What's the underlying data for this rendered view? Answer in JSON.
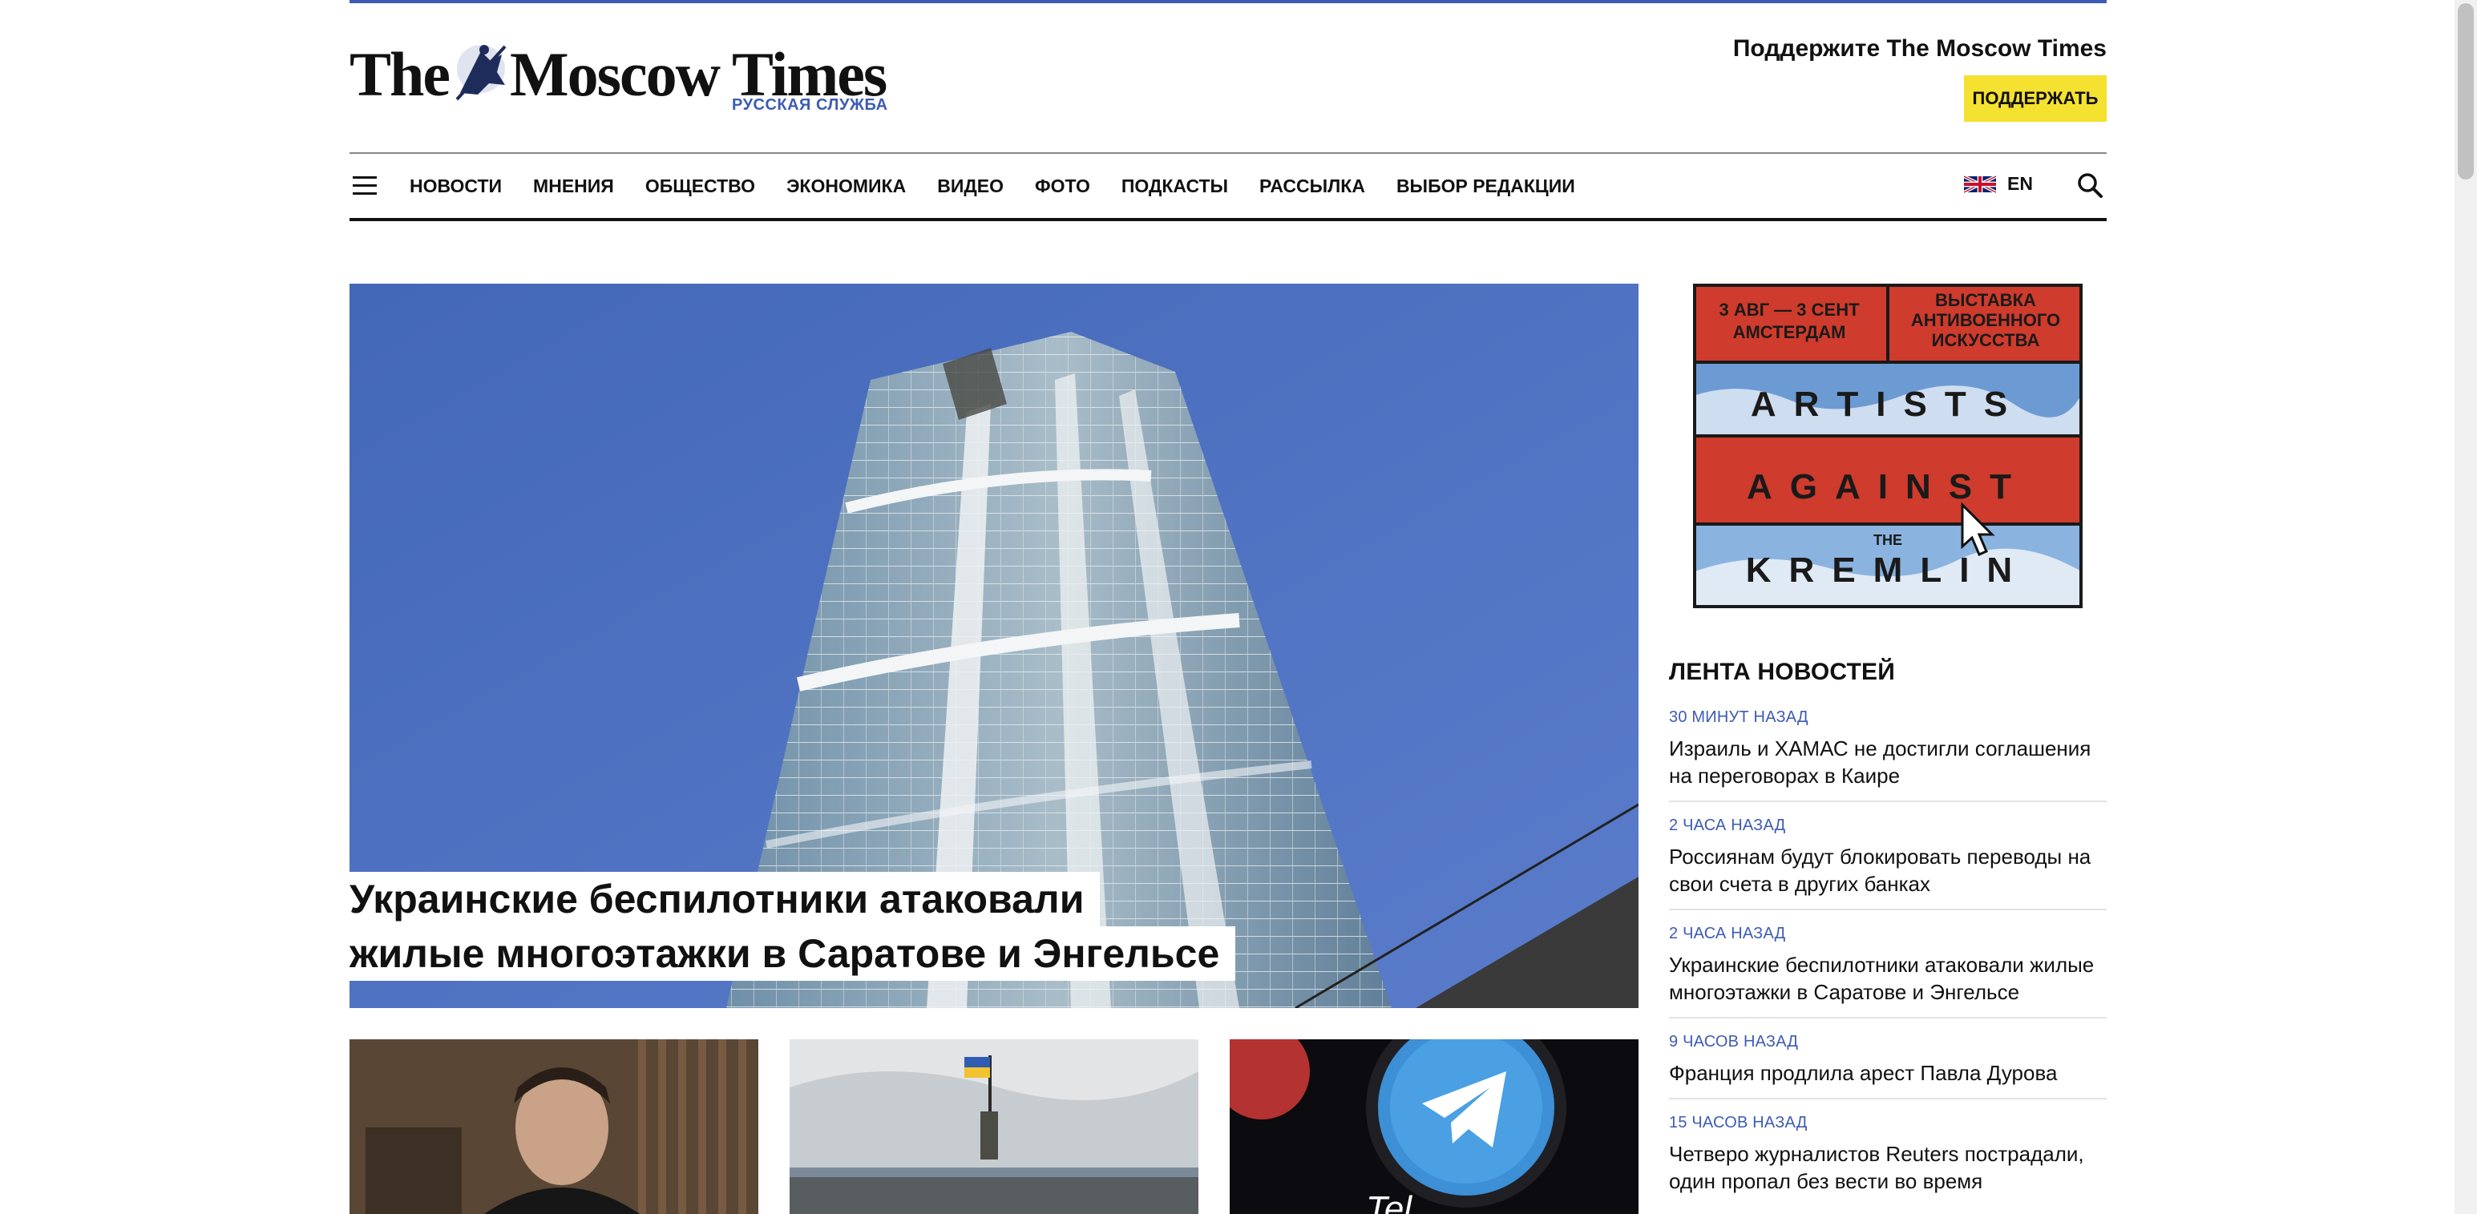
{
  "header": {
    "logo_the": "The",
    "logo_name": "Moscow Times",
    "logo_subtitle": "РУССКАЯ СЛУЖБА",
    "support_title": "Поддержите The Moscow Times",
    "support_button": "ПОДДЕРЖАТЬ"
  },
  "nav": {
    "items": [
      "НОВОСТИ",
      "МНЕНИЯ",
      "ОБЩЕСТВО",
      "ЭКОНОМИКА",
      "ВИДЕО",
      "ФОТО",
      "ПОДКАСТЫ",
      "РАССЫЛКА",
      "ВЫБОР РЕДАКЦИИ"
    ],
    "lang": "EN"
  },
  "hero": {
    "title_line1": "Украинские беспилотники атаковали",
    "title_line2": "жилые многоэтажки в Саратове и Энгельсе"
  },
  "ad": {
    "dates": "3 АВГ — 3 СЕНТ АМСТЕРДАМ",
    "dates_line1": "3 АВГ — 3 СЕНТ",
    "dates_line2": "АМСТЕРДАМ",
    "exhibit_line1": "ВЫСТАВКА",
    "exhibit_line2": "АНТИВОЕННОГО",
    "exhibit_line3": "ИСКУССТВА",
    "word1": "ARTISTS",
    "word2": "AGAINST",
    "word_small": "THE",
    "word3": "KREMLIN"
  },
  "feed": {
    "title": "ЛЕНТА НОВОСТЕЙ",
    "items": [
      {
        "time": "30 МИНУТ НАЗАД",
        "headline": "Израиль и ХАМАС не достигли соглашения на переговорах в Каире"
      },
      {
        "time": "2 ЧАСА НАЗАД",
        "headline": "Россиянам будут блокировать переводы на свои счета в других банках"
      },
      {
        "time": "2 ЧАСА НАЗАД",
        "headline": "Украинские беспилотники атаковали жилые многоэтажки в Саратове и Энгельсе"
      },
      {
        "time": "9 ЧАСОВ НАЗАД",
        "headline": "Франция продлила арест Павла Дурова"
      },
      {
        "time": "15 ЧАСОВ НАЗАД",
        "headline": "Четверо журналистов Reuters пострадали, один пропал без вести во время"
      }
    ]
  },
  "thumbs": {
    "telegram_text": "Tel"
  },
  "colors": {
    "accent": "#3d5bb5",
    "support_button": "#f5e12f",
    "ad_red": "#cf3b2c",
    "sky": "#4a6bbd"
  }
}
